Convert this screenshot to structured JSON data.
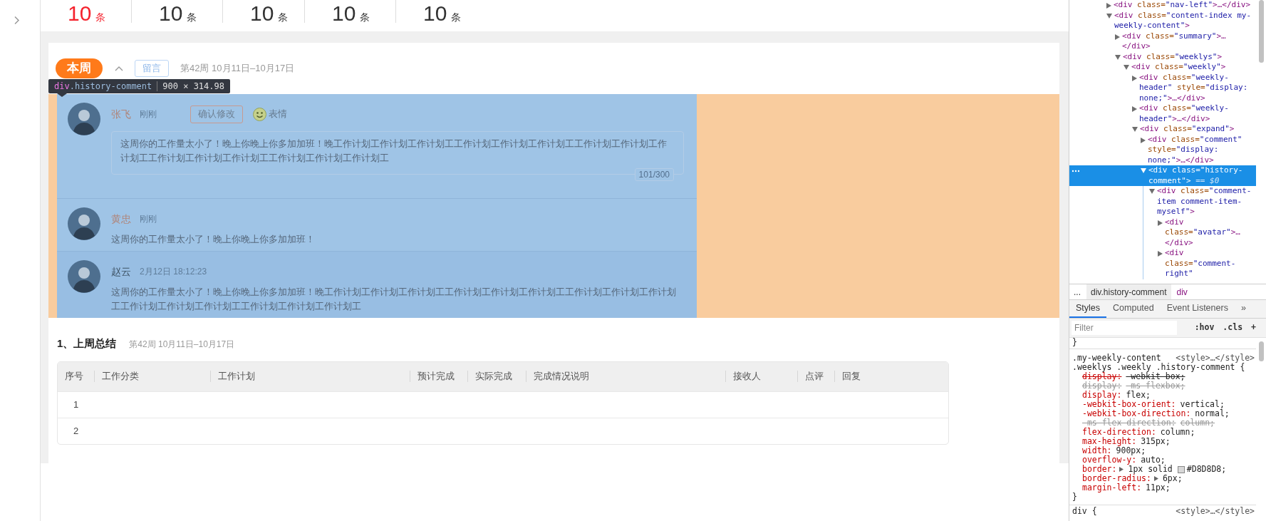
{
  "stats": [
    {
      "count": "10",
      "unit": "条",
      "highlighted": true
    },
    {
      "count": "10",
      "unit": "条",
      "highlighted": false
    },
    {
      "count": "10",
      "unit": "条",
      "highlighted": false
    },
    {
      "count": "10",
      "unit": "条",
      "highlighted": false
    },
    {
      "count": "10",
      "unit": "条",
      "highlighted": false
    }
  ],
  "week_header": {
    "tab": "本周",
    "comment_button": "留言",
    "period": "第42周 10月11日–10月17日"
  },
  "inspector_tooltip": {
    "tag": "div",
    "class_name": ".history-comment",
    "size": "900 × 314.98"
  },
  "comments": [
    {
      "kind": "editing",
      "author": "张飞",
      "mine": true,
      "time": "刚刚",
      "confirm_button": "确认修改",
      "emoji_button": "表情",
      "text": "这周你的工作量太小了！晚上你晚上你多加加班！晚工作计划工作计划工作计划工工作计划工作计划工作计划工工作计划工作计划工作计划工工作计划工作计划工作计划工工作计划工作计划工作计划工",
      "counter": "101/300"
    },
    {
      "kind": "plain",
      "author": "黄忠",
      "mine": true,
      "time": "刚刚",
      "text": "这周你的工作量太小了！晚上你晚上你多加加班！"
    },
    {
      "kind": "plain",
      "author": "赵云",
      "mine": false,
      "time": "2月12日 18:12:23",
      "text": "这周你的工作量太小了！晚上你晚上你多加加班！晚工作计划工作计划工作计划工工作计划工作计划工作计划工工作计划工作计划工作计划工工作计划工作计划工作计划工工作计划工作计划工作计划工"
    }
  ],
  "section": {
    "title": "1、上周总结",
    "period": "第42周 10月11日–10月17日"
  },
  "table": {
    "columns": [
      "序号",
      "工作分类",
      "工作计划",
      "预计完成",
      "实际完成",
      "完成情况说明",
      "接收人",
      "点评",
      "回复"
    ],
    "rows": [
      {
        "cells": [
          "1"
        ]
      },
      {
        "cells": [
          "2"
        ]
      }
    ]
  },
  "devtools": {
    "dom_tree": [
      {
        "tag": "<div",
        "attrs": [
          {
            "name": " class=",
            "value": "\"nav-left\""
          }
        ],
        "end": ">…</div>",
        "expanded": false,
        "selected": false
      },
      {
        "tag": "<div",
        "attrs": [
          {
            "name": " class=",
            "value": "\"content-index my-weekly-content\""
          }
        ],
        "end": ">",
        "expanded": true,
        "selected": false,
        "children": [
          {
            "tag": "<div",
            "attrs": [
              {
                "name": " class=",
                "value": "\"summary\""
              }
            ],
            "end": ">…</div>",
            "expanded": false,
            "selected": false
          },
          {
            "tag": "<div",
            "attrs": [
              {
                "name": " class=",
                "value": "\"weeklys\""
              }
            ],
            "end": ">",
            "expanded": true,
            "selected": false,
            "children": [
              {
                "tag": "<div",
                "attrs": [
                  {
                    "name": " class=",
                    "value": "\"weekly\""
                  }
                ],
                "end": ">",
                "expanded": true,
                "selected": false,
                "children": [
                  {
                    "tag": "<div",
                    "attrs": [
                      {
                        "name": " class=",
                        "value": "\"weekly-header\""
                      },
                      {
                        "name": " style=",
                        "value": "\"display: none;\""
                      }
                    ],
                    "end": ">…</div>",
                    "expanded": false,
                    "selected": false
                  },
                  {
                    "tag": "<div",
                    "attrs": [
                      {
                        "name": " class=",
                        "value": "\"weekly-header\""
                      }
                    ],
                    "end": ">…</div>",
                    "expanded": false,
                    "selected": false
                  },
                  {
                    "tag": "<div",
                    "attrs": [
                      {
                        "name": " class=",
                        "value": "\"expand\""
                      }
                    ],
                    "end": ">",
                    "expanded": true,
                    "selected": false,
                    "children": [
                      {
                        "tag": "<div",
                        "attrs": [
                          {
                            "name": " class=",
                            "value": "\"comment\""
                          },
                          {
                            "name": " style=",
                            "value": "\"display: none;\""
                          }
                        ],
                        "end": ">…</div>",
                        "expanded": false,
                        "selected": false
                      },
                      {
                        "tag": "<div",
                        "attrs": [
                          {
                            "name": " class=",
                            "value": "\"history-comment\""
                          }
                        ],
                        "end": ">",
                        "console_ref": " == $0",
                        "expanded": true,
                        "selected": true,
                        "children": [
                          {
                            "tag": "<div",
                            "attrs": [
                              {
                                "name": " class=",
                                "value": "\"comment-item comment-item-myself\""
                              }
                            ],
                            "end": ">",
                            "expanded": true,
                            "selected": false,
                            "children": [
                              {
                                "tag": "<div",
                                "attrs": [
                                  {
                                    "name": " class=",
                                    "value": "\"avatar\""
                                  }
                                ],
                                "end": ">…</div>",
                                "expanded": false,
                                "selected": false
                              },
                              {
                                "tag": "<div",
                                "attrs": [
                                  {
                                    "name": " class=",
                                    "value": "\"comment-right\""
                                  }
                                ],
                                "expanded": false,
                                "selected": false
                              }
                            ]
                          }
                        ]
                      }
                    ]
                  }
                ]
              }
            ]
          }
        ]
      }
    ],
    "breadcrumb": [
      {
        "label": "...",
        "selected": false
      },
      {
        "label": "div.history-comment",
        "selected": true
      },
      {
        "label": "div",
        "selected": false
      }
    ],
    "tabs": [
      {
        "label": "Styles",
        "selected": true
      },
      {
        "label": "Computed",
        "selected": false
      },
      {
        "label": "Event Listeners",
        "selected": false
      },
      {
        "label": "»",
        "selected": false
      }
    ],
    "filter": {
      "placeholder": "Filter"
    },
    "filter_buttons": [
      ":hov",
      ".cls",
      "+"
    ],
    "prev_rule_end": "}",
    "rule": {
      "selector_lines": [
        ".my-weekly-content",
        ".weeklys .weekly .history-comment {"
      ],
      "source": "<style>…</style>",
      "close": "}",
      "declarations": [
        {
          "name": "display:",
          "value": "-webkit-box;",
          "overridden": true,
          "invalid": false
        },
        {
          "name": "display:",
          "value": "-ms-flexbox;",
          "overridden": true,
          "invalid": true
        },
        {
          "name": "display:",
          "value": "flex;",
          "overridden": false,
          "invalid": false
        },
        {
          "name": "-webkit-box-orient:",
          "value": "vertical;",
          "overridden": false,
          "invalid": false
        },
        {
          "name": "-webkit-box-direction:",
          "value": "normal;",
          "overridden": false,
          "invalid": false
        },
        {
          "name": "-ms-flex-direction:",
          "value": "column;",
          "overridden": true,
          "invalid": true
        },
        {
          "name": "flex-direction:",
          "value": "column;",
          "overridden": false,
          "invalid": false
        },
        {
          "name": "max-height:",
          "value": "315px;",
          "overridden": false,
          "invalid": false
        },
        {
          "name": "width:",
          "value": "900px;",
          "overridden": false,
          "invalid": false
        },
        {
          "name": "overflow-y:",
          "value": "auto;",
          "overridden": false,
          "invalid": false
        },
        {
          "name": "border:",
          "value": "1px solid",
          "overridden": false,
          "invalid": false,
          "shorthand": true,
          "color": "#d8d8d8",
          "color_value": "#D8D8D8;"
        },
        {
          "name": "border-radius:",
          "value": "6px;",
          "overridden": false,
          "invalid": false,
          "shorthand": true
        },
        {
          "name": "margin-left:",
          "value": "11px;",
          "overridden": false,
          "invalid": false
        }
      ]
    },
    "next_rule": {
      "selector": "div {",
      "source": "<style>…</style>"
    }
  }
}
